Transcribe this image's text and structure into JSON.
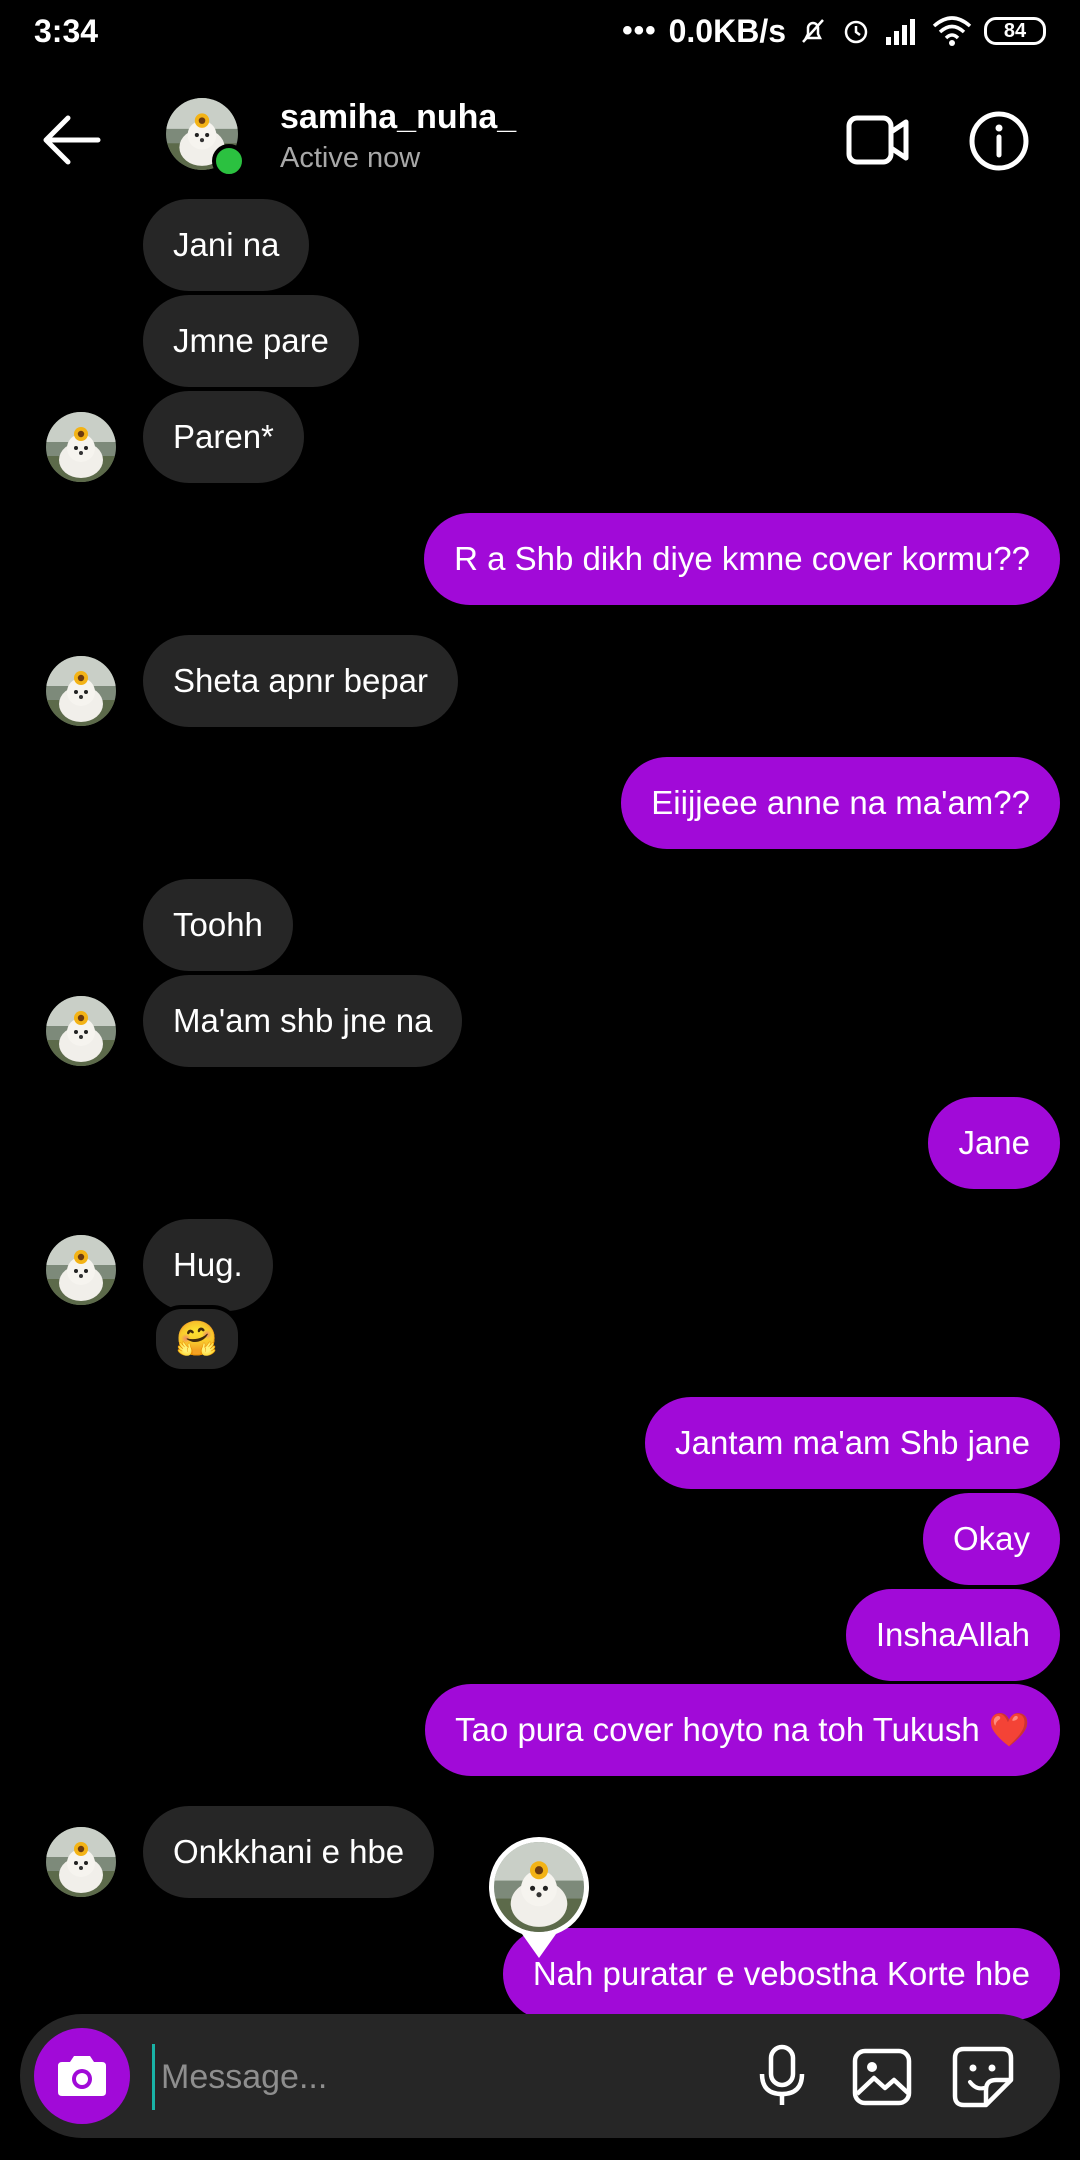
{
  "status_bar": {
    "time": "3:34",
    "net_speed": "0.0KB/s",
    "battery": "84"
  },
  "header": {
    "name": "samiha_nuha_",
    "status": "Active now"
  },
  "messages": [
    {
      "side": "in",
      "text": "Jani na"
    },
    {
      "side": "in",
      "text": "Jmne pare"
    },
    {
      "side": "in",
      "text": "Paren*"
    },
    {
      "side": "out",
      "text": "R a Shb dikh diye kmne cover kormu??"
    },
    {
      "side": "in",
      "text": "Sheta apnr bepar"
    },
    {
      "side": "out",
      "text": "Eiijjeee anne na ma'am??"
    },
    {
      "side": "in",
      "text": "Toohh"
    },
    {
      "side": "in",
      "text": "Ma'am shb jne na"
    },
    {
      "side": "out",
      "text": "Jane"
    },
    {
      "side": "in",
      "text": "Hug."
    },
    {
      "side": "out",
      "text": "Jantam ma'am Shb jane"
    },
    {
      "side": "out",
      "text": "Okay"
    },
    {
      "side": "out",
      "text": "InshaAllah"
    },
    {
      "side": "out",
      "text": "Tao pura cover hoyto na toh Tukush ❤️"
    },
    {
      "side": "in",
      "text": "Onkkhani e hbe"
    },
    {
      "side": "out",
      "text": "Nah puratar e vebostha Korte hbe"
    }
  ],
  "reaction": {
    "emoji": "🤗"
  },
  "composer": {
    "placeholder": "Message..."
  },
  "icons": {
    "back": "arrow-left-icon",
    "video": "video-camera-icon",
    "info": "info-icon",
    "camera": "camera-icon",
    "mic": "microphone-icon",
    "gallery": "image-icon",
    "sticker": "sticker-icon"
  },
  "colors": {
    "outgoing_bubble": "#a10ad8",
    "incoming_bubble": "#262626",
    "online": "#2bc140"
  }
}
